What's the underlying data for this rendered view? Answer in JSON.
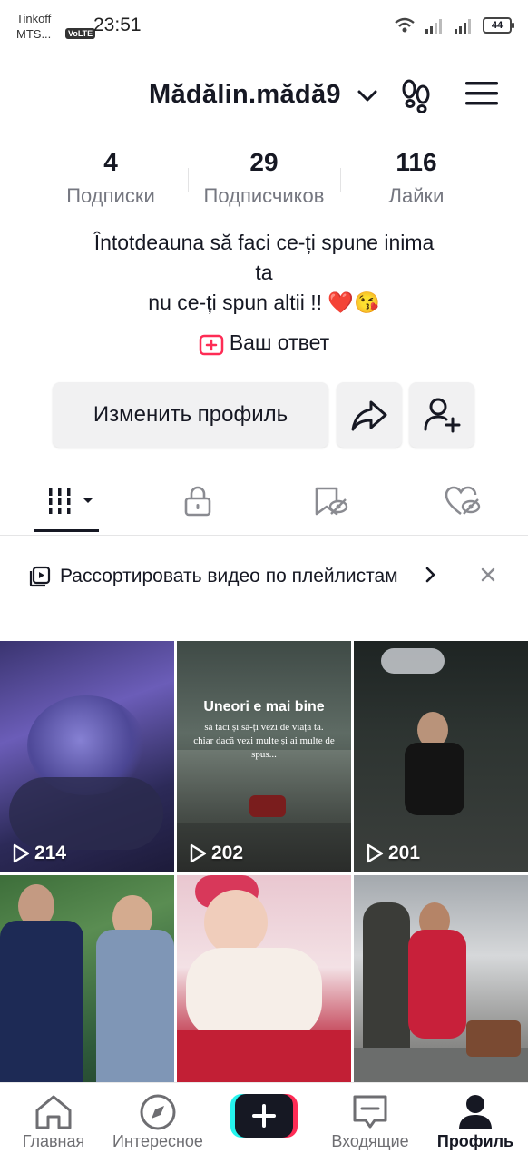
{
  "status": {
    "carrier_line1": "Tinkoff",
    "carrier_line2": "MTS...",
    "volte": "VoLTE",
    "time": "23:51",
    "battery": "44"
  },
  "header": {
    "username": "Mădălin.mădă9",
    "icons": [
      "chevron-down-icon",
      "footprints-icon",
      "menu-icon"
    ]
  },
  "stats": [
    {
      "value": "4",
      "label": "Подписки"
    },
    {
      "value": "29",
      "label": "Подписчиков"
    },
    {
      "value": "116",
      "label": "Лайки"
    }
  ],
  "bio": {
    "line1": "Întotdeauna să faci ce-ți spune inima",
    "line2": "ta",
    "line3": "nu ce-ți spun altii !! ❤️😘"
  },
  "answer_label": "Ваш ответ",
  "actions": {
    "edit_profile": "Изменить профиль"
  },
  "tabs": [
    "videos-grid-icon",
    "lock-icon",
    "bookmark-hidden-icon",
    "liked-hidden-icon"
  ],
  "banner": {
    "text": "Рассортировать видео по плейлистам"
  },
  "videos": [
    {
      "views": "214"
    },
    {
      "views": "202",
      "title": "Uneori e mai bine",
      "caption": "să taci și să-ți vezi de viața ta. chiar dacă vezi multe și ai multe de spus..."
    },
    {
      "views": "201"
    },
    {
      "views": ""
    },
    {
      "views": ""
    },
    {
      "views": ""
    }
  ],
  "nav": {
    "home": "Главная",
    "discover": "Интересное",
    "inbox": "Входящие",
    "profile": "Профиль"
  },
  "colors": {
    "accent_red": "#fe2c55",
    "accent_cyan": "#25f4ee",
    "text_primary": "#161823",
    "text_secondary": "#757780"
  }
}
